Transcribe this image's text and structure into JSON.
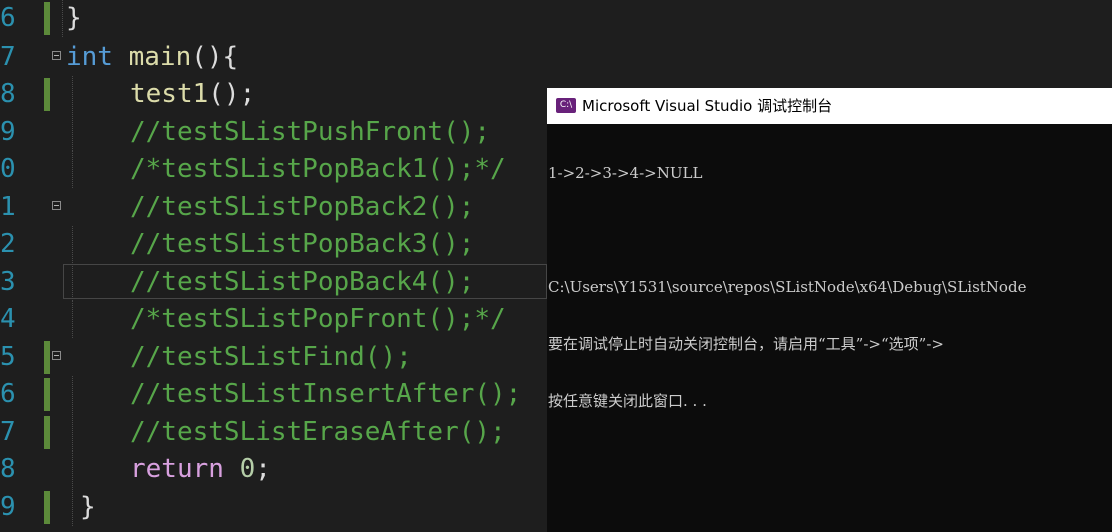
{
  "editor": {
    "lines": [
      {
        "no": "6"
      },
      {
        "no": "7"
      },
      {
        "no": "8"
      },
      {
        "no": "9"
      },
      {
        "no": "0"
      },
      {
        "no": "1"
      },
      {
        "no": "2"
      },
      {
        "no": "3"
      },
      {
        "no": "4"
      },
      {
        "no": "5"
      },
      {
        "no": "6"
      },
      {
        "no": "7"
      },
      {
        "no": "8"
      },
      {
        "no": "9"
      }
    ],
    "code": {
      "close_brace_prev": "}",
      "kw_int": "int",
      "main_name": "main",
      "main_rest": "(){",
      "test1_name": "test1",
      "test1_rest": "();",
      "c1": "//testSListPushFront();",
      "c2": "/*testSListPopBack1();*/",
      "c3": "//testSListPopBack2();",
      "c4": "//testSListPopBack3();",
      "c5": "//testSListPopBack4();",
      "c6": "/*testSListPopFront();*/",
      "c7": "//testSListFind();",
      "c8": "//testSListInsertAfter();",
      "c9": "//testSListEraseAfter();",
      "kw_return": "return",
      "ret_val": "0",
      "ret_semi": ";",
      "close_brace": "}"
    }
  },
  "console": {
    "icon_label": "C:\\",
    "title": "Microsoft Visual Studio 调试控制台",
    "output": [
      "1->2->3->4->NULL",
      "",
      "C:\\Users\\Y1531\\source\\repos\\SListNode\\x64\\Debug\\SListNode",
      "要在调试停止时自动关闭控制台，请启用“工具”->“选项”->",
      "按任意键关闭此窗口. . ."
    ]
  },
  "colors": {
    "background": "#1e1e1e",
    "line_number": "#2b91af",
    "keyword": "#569cd6",
    "function": "#dcdcaa",
    "comment": "#57a64a",
    "control_keyword": "#d8a0df",
    "number": "#b5cea8",
    "change_marker": "#5c8a3a",
    "console_bg": "#0c0c0c",
    "console_text": "#cccccc"
  }
}
